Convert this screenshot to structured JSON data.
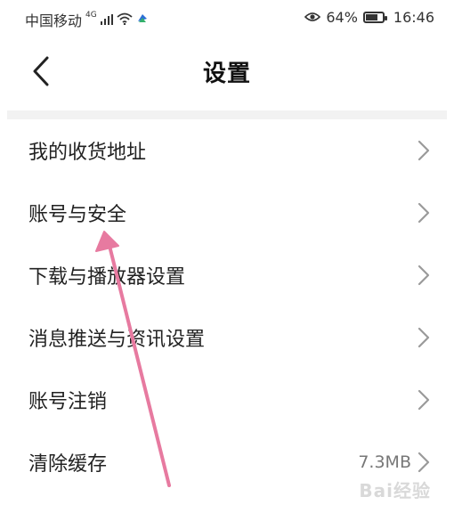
{
  "status_bar": {
    "carrier": "中国移动",
    "network": "4G",
    "battery_percent": "64%",
    "time": "16:46",
    "icons": [
      "signal-icon",
      "wifi-icon",
      "app-notification-icon",
      "eye-icon",
      "battery-icon"
    ]
  },
  "header": {
    "title": "设置",
    "back_icon": "chevron-left-icon"
  },
  "settings": {
    "items": [
      {
        "label": "我的收货地址",
        "value": ""
      },
      {
        "label": "账号与安全",
        "value": ""
      },
      {
        "label": "下载与播放器设置",
        "value": ""
      },
      {
        "label": "消息推送与资讯设置",
        "value": ""
      },
      {
        "label": "账号注销",
        "value": ""
      },
      {
        "label": "清除缓存",
        "value": "7.3MB"
      }
    ]
  },
  "annotation": {
    "arrow_color": "#e77aa0",
    "points_to": "账号与安全"
  },
  "watermark": {
    "text": "Bai经验"
  }
}
